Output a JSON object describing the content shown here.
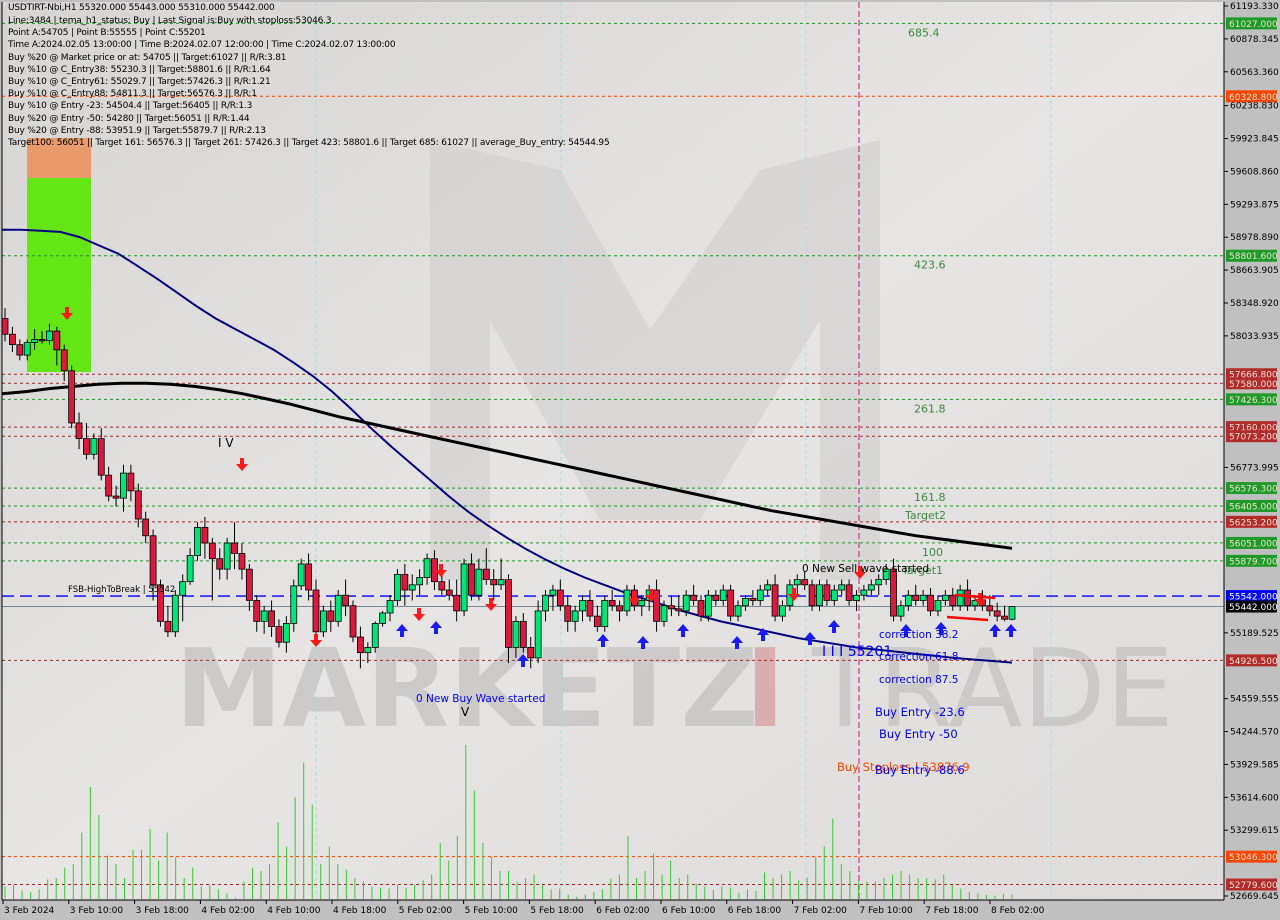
{
  "header": {
    "title": "USDTIRT-Nbi,H1  55320.000 55443.000 55310.000 55442.000",
    "info_lines": [
      "Line:3484 | tema_h1_status: Buy | Last Signal is:Buy with stoploss:53046.3",
      "Point A:54705 | Point B:55555 | Point C:55201",
      "Time A:2024.02.05 13:00:00 | Time B:2024.02.07 12:00:00 | Time C:2024.02.07 13:00:00",
      "Buy %20 @ Market price or at: 54705 || Target:61027 || R/R:3.81",
      "Buy %10 @ C_Entry38: 55230.3 || Target:58801.6 || R/R:1.64",
      "Buy %10 @ C_Entry61: 55029.7 || Target:57426.3 || R/R:1.21",
      "Buy %10 @ C_Entry88: 54811.3 || Target:56576.3 || R/R:1",
      "Buy %10 @ Entry -23: 54504.4 || Target:56405 || R/R:1.3",
      "Buy %20 @ Entry -50: 54280 || Target:56051 || R/R:1.44",
      "Buy %20 @ Entry -88: 53951.9 || Target:55879.7 || R/R:2.13",
      "Target100: 56051 || Target 161: 56576.3 || Target 261: 57426.3 || Target 423: 58801.6 || Target 685: 61027 || average_Buy_entry: 54544.95"
    ]
  },
  "watermark": {
    "left": "MARKETZ",
    "accent": "I",
    "right": "TRADE"
  },
  "colors": {
    "background": "#dcdcdc",
    "bull": "#00e676",
    "bear": "#d81b3c",
    "green_line": "#228b22",
    "red_line": "#a52a2a",
    "orange_line": "#ff4500",
    "blue_ma": "#000080",
    "black_ma": "#000000",
    "volume": "#32cd32",
    "magenta": "#d0109a"
  },
  "chart_data": {
    "type": "candlestick",
    "symbol": "USDTIRT-Nbi",
    "timeframe": "H1",
    "ohlc_last": {
      "open": 55320.0,
      "high": 55443.0,
      "low": 55310.0,
      "close": 55442.0
    },
    "ylim": [
      52669.645,
      61193.33
    ],
    "y_ticks": [
      "61193.330",
      "60878.345",
      "60563.360",
      "60238.830",
      "59923.845",
      "59608.860",
      "59293.875",
      "58978.890",
      "58663.905",
      "58348.920",
      "58033.935",
      "56773.995",
      "55189.525",
      "54559.555",
      "54244.570",
      "53929.585",
      "53614.600",
      "53299.615",
      "52669.645"
    ],
    "x_ticks": [
      "3 Feb 2024",
      "3 Feb 10:00",
      "3 Feb 18:00",
      "4 Feb 02:00",
      "4 Feb 10:00",
      "4 Feb 18:00",
      "5 Feb 02:00",
      "5 Feb 10:00",
      "5 Feb 18:00",
      "6 Feb 02:00",
      "6 Feb 10:00",
      "6 Feb 18:00",
      "7 Feb 02:00",
      "7 Feb 10:00",
      "7 Feb 18:00",
      "8 Feb 02:00"
    ],
    "price_levels": [
      {
        "value": 61027.0,
        "label": "61027.000",
        "color": "green"
      },
      {
        "value": 60328.8,
        "label": "60328.800",
        "color": "orange"
      },
      {
        "value": 58801.6,
        "label": "58801.600",
        "color": "green"
      },
      {
        "value": 57666.8,
        "label": "57666.800",
        "color": "red"
      },
      {
        "value": 57580.0,
        "label": "57580.000",
        "color": "red"
      },
      {
        "value": 57426.3,
        "label": "57426.300",
        "color": "green"
      },
      {
        "value": 57160.0,
        "label": "57160.000",
        "color": "red"
      },
      {
        "value": 57073.2,
        "label": "57073.200",
        "color": "red"
      },
      {
        "value": 56576.3,
        "label": "56576.300",
        "color": "green"
      },
      {
        "value": 56405.0,
        "label": "56405.000",
        "color": "green"
      },
      {
        "value": 56253.2,
        "label": "56253.200",
        "color": "red"
      },
      {
        "value": 56051.0,
        "label": "56051.000",
        "color": "green"
      },
      {
        "value": 55879.7,
        "label": "55879.700",
        "color": "green"
      },
      {
        "value": 55542.0,
        "label": "55542.000",
        "color": "blue"
      },
      {
        "value": 55442.0,
        "label": "55442.000",
        "color": "black"
      },
      {
        "value": 54926.5,
        "label": "54926.500",
        "color": "red"
      },
      {
        "value": 53046.3,
        "label": "53046.300",
        "color": "orange"
      },
      {
        "value": 52779.6,
        "label": "52779.600",
        "color": "red"
      }
    ],
    "fib_labels": [
      {
        "text": "685.4",
        "value": 61027.0
      },
      {
        "text": "423.6",
        "value": 58801.6
      },
      {
        "text": "261.8",
        "value": 57426.3
      },
      {
        "text": "161.8",
        "value": 56576.3
      },
      {
        "text": "Target2",
        "value": 56405.0
      },
      {
        "text": "100",
        "value": 56051.0
      },
      {
        "text": "Target1",
        "value": 55879.7
      }
    ],
    "annotations": [
      {
        "text": "FSB-HighToBreak | 55542",
        "color": "#000"
      },
      {
        "text": "0 New Sell wave started",
        "color": "#000"
      },
      {
        "text": "0 New Buy Wave started",
        "color": "#0000ff"
      },
      {
        "text": "I V",
        "color": "#000"
      },
      {
        "text": "V",
        "color": "#000"
      },
      {
        "text": "I I I 55201",
        "color": "#0000ff"
      },
      {
        "text": "correction 38.2",
        "color": "#0000ff"
      },
      {
        "text": "correction 61.8",
        "color": "#0000ff"
      },
      {
        "text": "correction 87.5",
        "color": "#0000ff"
      },
      {
        "text": "Buy Entry -23.6",
        "color": "#0000ff"
      },
      {
        "text": "Buy Entry -50",
        "color": "#0000ff"
      },
      {
        "text": "Buy Stoploss | 53876.9",
        "color": "#ff4500"
      },
      {
        "text": "Buy Entry -88.6",
        "color": "#0000ff"
      }
    ],
    "candles": [
      [
        58200,
        58300,
        57980,
        58050
      ],
      [
        58050,
        58120,
        57880,
        57950
      ],
      [
        57950,
        58000,
        57800,
        57850
      ],
      [
        57850,
        58000,
        57800,
        57970
      ],
      [
        57970,
        58100,
        57900,
        58000
      ],
      [
        58000,
        58080,
        57960,
        57990
      ],
      [
        57990,
        58150,
        57950,
        58080
      ],
      [
        58080,
        58120,
        57750,
        57900
      ],
      [
        57900,
        57950,
        57600,
        57700
      ],
      [
        57700,
        57750,
        57150,
        57200
      ],
      [
        57200,
        57300,
        56950,
        57050
      ],
      [
        57050,
        57200,
        56850,
        56900
      ],
      [
        56900,
        57100,
        56850,
        57050
      ],
      [
        57050,
        57150,
        56650,
        56700
      ],
      [
        56700,
        56780,
        56450,
        56500
      ],
      [
        56500,
        56600,
        56400,
        56480
      ],
      [
        56480,
        56800,
        56350,
        56720
      ],
      [
        56720,
        56800,
        56450,
        56550
      ],
      [
        56550,
        56620,
        56200,
        56280
      ],
      [
        56280,
        56350,
        56050,
        56120
      ],
      [
        56120,
        56180,
        55500,
        55650
      ],
      [
        55650,
        55700,
        55250,
        55300
      ],
      [
        55300,
        55450,
        55150,
        55200
      ],
      [
        55200,
        55600,
        55150,
        55550
      ],
      [
        55550,
        55750,
        55300,
        55680
      ],
      [
        55680,
        56000,
        55650,
        55930
      ],
      [
        55930,
        56250,
        55880,
        56200
      ],
      [
        56200,
        56300,
        55900,
        56050
      ],
      [
        56050,
        56100,
        55500,
        55900
      ],
      [
        55900,
        56000,
        55700,
        55800
      ],
      [
        55800,
        56100,
        55700,
        56050
      ],
      [
        56050,
        56250,
        55800,
        55950
      ],
      [
        55950,
        56050,
        55700,
        55800
      ],
      [
        55800,
        55850,
        55400,
        55500
      ],
      [
        55500,
        55550,
        55200,
        55300
      ],
      [
        55300,
        55450,
        55180,
        55400
      ],
      [
        55400,
        55500,
        55150,
        55250
      ],
      [
        55250,
        55320,
        55050,
        55100
      ],
      [
        55100,
        55350,
        55000,
        55280
      ],
      [
        55280,
        55700,
        55200,
        55640
      ],
      [
        55640,
        55900,
        55600,
        55850
      ],
      [
        55850,
        55950,
        55500,
        55600
      ],
      [
        55600,
        55700,
        55100,
        55200
      ],
      [
        55200,
        55450,
        55150,
        55400
      ],
      [
        55400,
        55500,
        55200,
        55300
      ],
      [
        55300,
        55600,
        55250,
        55550
      ],
      [
        55550,
        55700,
        55350,
        55450
      ],
      [
        55450,
        55500,
        55100,
        55150
      ],
      [
        55150,
        55250,
        54850,
        55000
      ],
      [
        55000,
        55100,
        54900,
        55050
      ],
      [
        55050,
        55300,
        55000,
        55280
      ],
      [
        55280,
        55400,
        55250,
        55380
      ],
      [
        55380,
        55550,
        55300,
        55500
      ],
      [
        55500,
        55800,
        55450,
        55750
      ],
      [
        55750,
        55850,
        55450,
        55600
      ],
      [
        55600,
        55750,
        55500,
        55650
      ],
      [
        55650,
        55800,
        55550,
        55720
      ],
      [
        55720,
        55950,
        55650,
        55900
      ],
      [
        55900,
        55980,
        55600,
        55680
      ],
      [
        55680,
        55800,
        55550,
        55600
      ],
      [
        55600,
        55700,
        55500,
        55550
      ],
      [
        55550,
        55700,
        55300,
        55400
      ],
      [
        55400,
        55900,
        55350,
        55850
      ],
      [
        55850,
        55950,
        55500,
        55550
      ],
      [
        55550,
        55900,
        55500,
        55800
      ],
      [
        55800,
        56000,
        55650,
        55700
      ],
      [
        55700,
        55800,
        55500,
        55650
      ],
      [
        55650,
        55900,
        55600,
        55700
      ],
      [
        55700,
        55750,
        54900,
        55050
      ],
      [
        55050,
        55350,
        54950,
        55300
      ],
      [
        55300,
        55380,
        55000,
        55050
      ],
      [
        55050,
        55150,
        54850,
        54950
      ],
      [
        54950,
        55500,
        54900,
        55400
      ],
      [
        55400,
        55600,
        55300,
        55550
      ],
      [
        55550,
        55650,
        55400,
        55600
      ],
      [
        55600,
        55700,
        55400,
        55450
      ],
      [
        55450,
        55550,
        55200,
        55300
      ],
      [
        55300,
        55450,
        55200,
        55400
      ],
      [
        55400,
        55550,
        55300,
        55500
      ],
      [
        55500,
        55600,
        55300,
        55350
      ],
      [
        55350,
        55450,
        55200,
        55250
      ],
      [
        55250,
        55550,
        55200,
        55500
      ],
      [
        55500,
        55600,
        55400,
        55450
      ],
      [
        55450,
        55500,
        55300,
        55400
      ],
      [
        55400,
        55650,
        55350,
        55600
      ],
      [
        55600,
        55650,
        55400,
        55450
      ],
      [
        55450,
        55550,
        55350,
        55500
      ],
      [
        55500,
        55650,
        55400,
        55600
      ],
      [
        55600,
        55700,
        55200,
        55300
      ],
      [
        55300,
        55500,
        55250,
        55450
      ],
      [
        55450,
        55550,
        55350,
        55420
      ],
      [
        55420,
        55550,
        55350,
        55400
      ],
      [
        55400,
        55600,
        55350,
        55550
      ],
      [
        55550,
        55650,
        55450,
        55500
      ],
      [
        55500,
        55550,
        55300,
        55350
      ],
      [
        55350,
        55600,
        55300,
        55550
      ],
      [
        55550,
        55600,
        55450,
        55500
      ],
      [
        55500,
        55650,
        55450,
        55600
      ],
      [
        55600,
        55650,
        55300,
        55350
      ],
      [
        55350,
        55500,
        55300,
        55450
      ],
      [
        55450,
        55550,
        55400,
        55520
      ],
      [
        55520,
        55600,
        55450,
        55500
      ],
      [
        55500,
        55650,
        55450,
        55600
      ],
      [
        55600,
        55700,
        55550,
        55650
      ],
      [
        55650,
        55750,
        55300,
        55350
      ],
      [
        55350,
        55500,
        55300,
        55450
      ],
      [
        55450,
        55700,
        55400,
        55650
      ],
      [
        55650,
        55750,
        55550,
        55700
      ],
      [
        55700,
        55780,
        55600,
        55650
      ],
      [
        55650,
        55700,
        55400,
        55450
      ],
      [
        55450,
        55700,
        55400,
        55650
      ],
      [
        55650,
        55700,
        55450,
        55500
      ],
      [
        55500,
        55650,
        55450,
        55600
      ],
      [
        55600,
        55700,
        55550,
        55650
      ],
      [
        55650,
        55700,
        55450,
        55500
      ],
      [
        55500,
        55600,
        55400,
        55550
      ],
      [
        55550,
        55650,
        55500,
        55600
      ],
      [
        55600,
        55700,
        55550,
        55650
      ],
      [
        55650,
        55750,
        55550,
        55700
      ],
      [
        55700,
        55850,
        55650,
        55800
      ],
      [
        55800,
        55900,
        55300,
        55350
      ],
      [
        55350,
        55500,
        55300,
        55450
      ],
      [
        55450,
        55600,
        55400,
        55550
      ],
      [
        55550,
        55650,
        55450,
        55500
      ],
      [
        55500,
        55600,
        55450,
        55550
      ],
      [
        55550,
        55620,
        55350,
        55400
      ],
      [
        55400,
        55550,
        55350,
        55500
      ],
      [
        55500,
        55600,
        55450,
        55550
      ],
      [
        55550,
        55620,
        55400,
        55450
      ],
      [
        55450,
        55650,
        55400,
        55600
      ],
      [
        55600,
        55700,
        55400,
        55450
      ],
      [
        55450,
        55550,
        55400,
        55500
      ],
      [
        55500,
        55600,
        55400,
        55450
      ],
      [
        55450,
        55550,
        55350,
        55400
      ],
      [
        55400,
        55480,
        55300,
        55350
      ],
      [
        55350,
        55450,
        55300,
        55320
      ],
      [
        55320,
        55443,
        55310,
        55442
      ]
    ],
    "blue_ma": [
      59050,
      59050,
      59040,
      59030,
      58980,
      58900,
      58820,
      58700,
      58580,
      58450,
      58320,
      58200,
      58100,
      58000,
      57900,
      57780,
      57650,
      57500,
      57330,
      57150,
      56980,
      56820,
      56660,
      56500,
      56350,
      56220,
      56100,
      55990,
      55890,
      55800,
      55720,
      55650,
      55580,
      55520,
      55460,
      55400,
      55350,
      55300,
      55260,
      55220,
      55180,
      55140,
      55110,
      55080,
      55050,
      55030,
      55010,
      54990,
      54970,
      54950,
      54935,
      54920,
      54905
    ],
    "black_ma": [
      57480,
      57500,
      57530,
      57550,
      57570,
      57580,
      57580,
      57570,
      57550,
      57520,
      57480,
      57430,
      57380,
      57320,
      57260,
      57210,
      57160,
      57110,
      57060,
      57010,
      56960,
      56910,
      56860,
      56810,
      56760,
      56710,
      56660,
      56610,
      56560,
      56510,
      56460,
      56410,
      56360,
      56320,
      56280,
      56240,
      56200,
      56160,
      56120,
      56090,
      56060,
      56030,
      56000
    ],
    "volume": [
      18,
      20,
      12,
      10,
      14,
      28,
      30,
      45,
      50,
      95,
      160,
      120,
      62,
      50,
      30,
      70,
      70,
      100,
      55,
      95,
      60,
      30,
      45,
      18,
      20,
      14,
      8,
      2,
      25,
      45,
      40,
      50,
      110,
      75,
      145,
      195,
      135,
      50,
      75,
      50,
      42,
      30,
      25,
      18,
      16,
      15,
      20,
      16,
      20,
      27,
      35,
      80,
      55,
      90,
      220,
      155,
      80,
      60,
      40,
      40,
      24,
      30,
      35,
      20,
      14,
      15,
      6,
      3,
      6,
      10,
      14,
      29,
      35,
      90,
      30,
      40,
      65,
      35,
      55,
      30,
      35,
      22,
      18,
      13,
      18,
      16,
      9,
      14,
      12,
      38,
      30,
      35,
      40,
      27,
      30,
      60,
      75,
      115,
      50,
      40,
      25,
      25,
      25,
      30,
      35,
      40,
      35,
      30,
      30,
      28,
      35,
      20,
      15,
      10,
      8,
      6,
      5,
      7,
      6
    ]
  }
}
